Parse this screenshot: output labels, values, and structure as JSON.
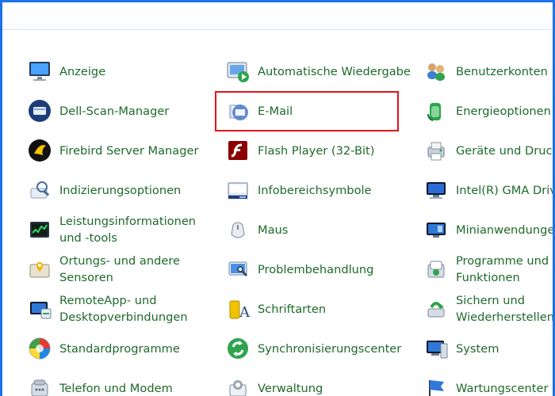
{
  "colors": {
    "link": "#1e6a2a",
    "highlight": "#e3141b",
    "window_border": "#1e73e6"
  },
  "items": [
    {
      "label": "Anzeige",
      "icon": "display-icon"
    },
    {
      "label": "Automatische Wiedergabe",
      "icon": "autoplay-icon"
    },
    {
      "label": "Benutzerkonten",
      "icon": "user-accounts-icon"
    },
    {
      "label": "Dell-Scan-Manager",
      "icon": "scanner-icon"
    },
    {
      "label": "E-Mail",
      "icon": "email-icon"
    },
    {
      "label": "Energieoptionen",
      "icon": "power-options-icon"
    },
    {
      "label": "Firebird Server Manager",
      "icon": "firebird-icon"
    },
    {
      "label": "Flash Player (32-Bit)",
      "icon": "flash-icon"
    },
    {
      "label": "Geräte und Druck",
      "icon": "devices-printers-icon"
    },
    {
      "label": "Indizierungsoptionen",
      "icon": "indexing-icon"
    },
    {
      "label": "Infobereichsymbole",
      "icon": "notification-area-icon"
    },
    {
      "label": "Intel(R) GMA Driv",
      "icon": "intel-gma-icon"
    },
    {
      "label": "Leistungsinformationen\nund -tools",
      "icon": "performance-icon"
    },
    {
      "label": "Maus",
      "icon": "mouse-icon"
    },
    {
      "label": "Minianwendunge",
      "icon": "gadgets-icon"
    },
    {
      "label": "Ortungs- und andere\nSensoren",
      "icon": "location-sensors-icon"
    },
    {
      "label": "Problembehandlung",
      "icon": "troubleshooting-icon"
    },
    {
      "label": "Programme und\nFunktionen",
      "icon": "programs-features-icon"
    },
    {
      "label": "RemoteApp- und\nDesktopverbindungen",
      "icon": "remoteapp-icon"
    },
    {
      "label": "Schriftarten",
      "icon": "fonts-icon"
    },
    {
      "label": "Sichern und\nWiederherstellen",
      "icon": "backup-restore-icon"
    },
    {
      "label": "Standardprogramme",
      "icon": "default-programs-icon"
    },
    {
      "label": "Synchronisierungscenter",
      "icon": "sync-center-icon"
    },
    {
      "label": "System",
      "icon": "system-icon"
    },
    {
      "label": "Telefon und Modem",
      "icon": "phone-modem-icon"
    },
    {
      "label": "Verwaltung",
      "icon": "administrative-tools-icon"
    },
    {
      "label": "Wartungscenter",
      "icon": "action-center-icon"
    }
  ]
}
